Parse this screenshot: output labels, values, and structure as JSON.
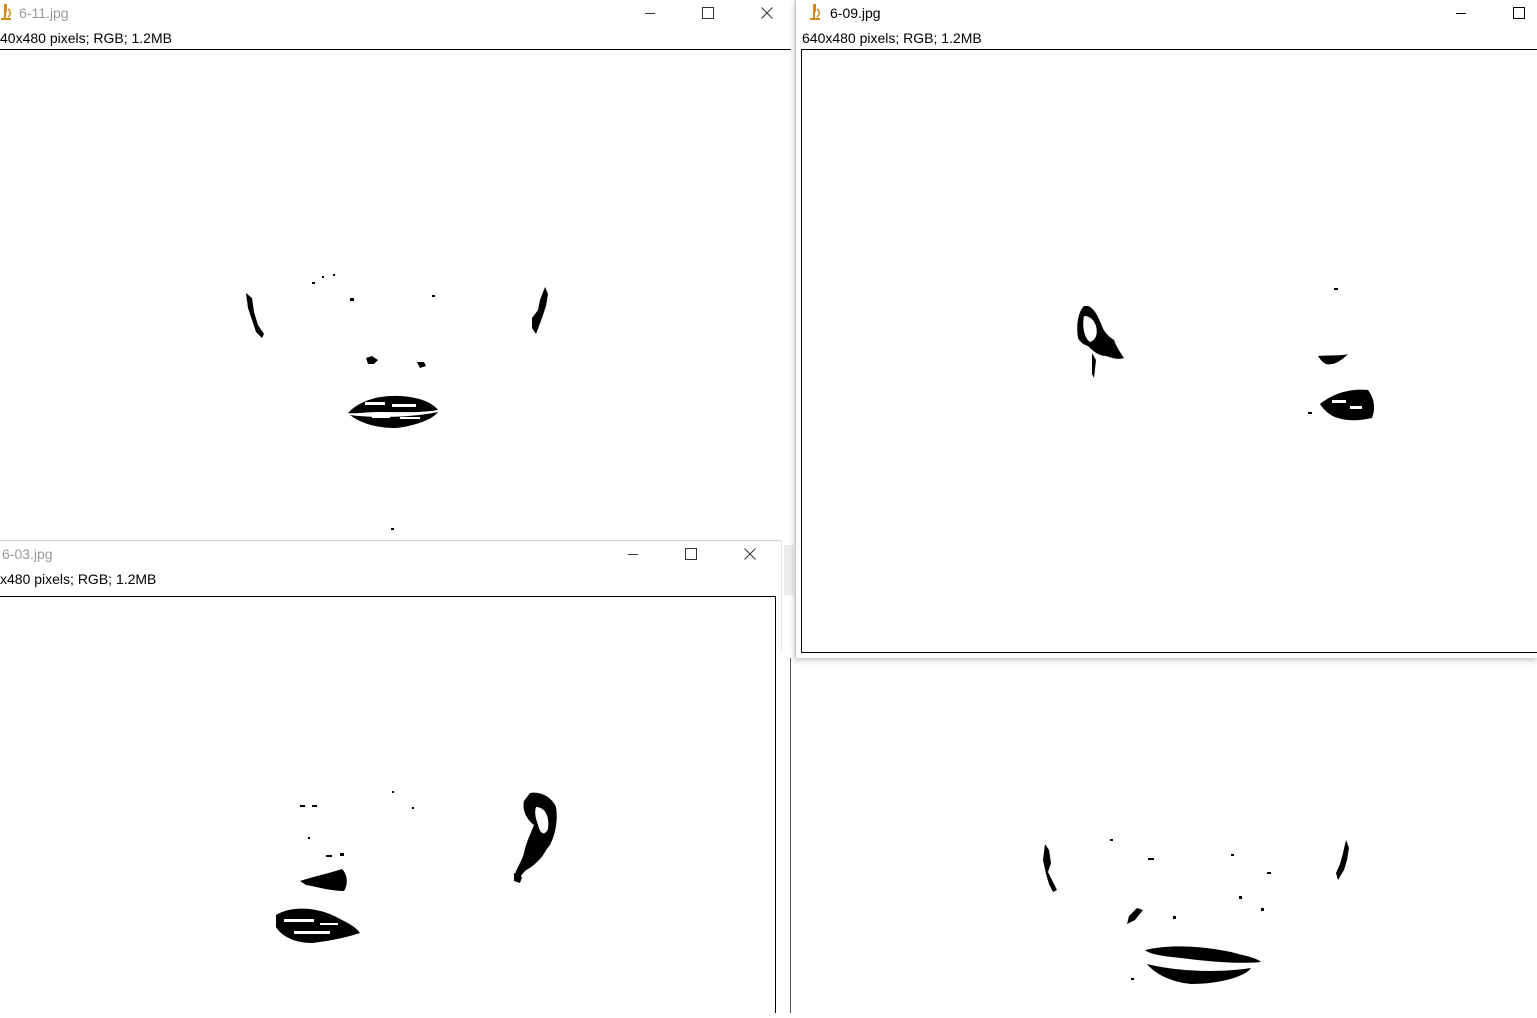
{
  "windows": {
    "w611": {
      "title": "6-11.jpg",
      "info": "40x480 pixels; RGB; 1.2MB",
      "icon": "microscope-icon"
    },
    "w609": {
      "title": "6-09.jpg",
      "info": "640x480 pixels; RGB; 1.2MB",
      "icon": "microscope-icon"
    },
    "w603": {
      "title": "6-03.jpg",
      "info": "x480 pixels; RGB; 1.2MB",
      "icon": ""
    }
  },
  "colors": {
    "ink": "#000000",
    "inactive_title": "#9a9a9a",
    "accent_icon": "#d88a1c"
  }
}
